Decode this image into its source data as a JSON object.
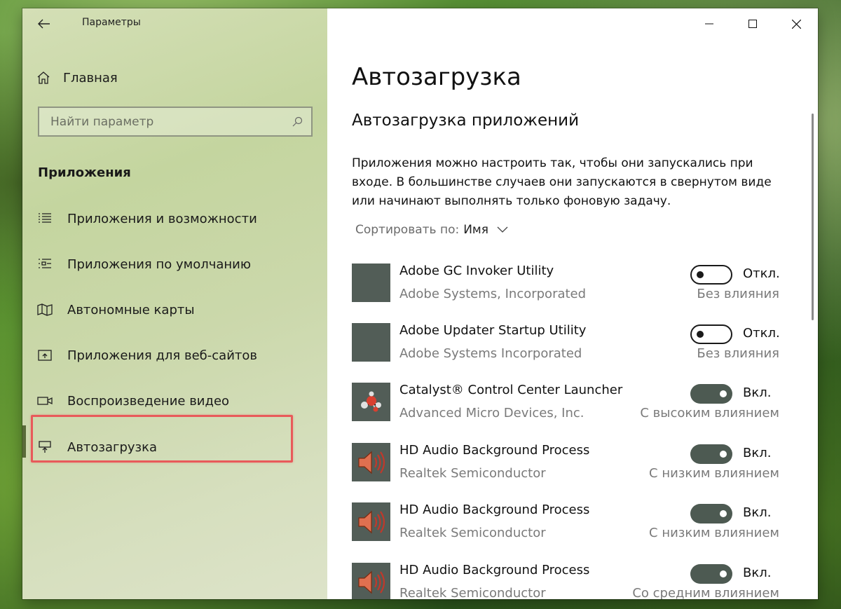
{
  "window": {
    "title": "Параметры"
  },
  "sidebar": {
    "home_label": "Главная",
    "search_placeholder": "Найти параметр",
    "section_title": "Приложения",
    "items": [
      {
        "label": "Приложения и возможности",
        "icon": "apps-features-icon"
      },
      {
        "label": "Приложения по умолчанию",
        "icon": "default-apps-icon"
      },
      {
        "label": "Автономные карты",
        "icon": "offline-maps-icon"
      },
      {
        "label": "Приложения для веб-сайтов",
        "icon": "apps-websites-icon"
      },
      {
        "label": "Воспроизведение видео",
        "icon": "video-playback-icon"
      },
      {
        "label": "Автозагрузка",
        "icon": "startup-icon",
        "active": true
      }
    ]
  },
  "main": {
    "title": "Автозагрузка",
    "subheading": "Автозагрузка приложений",
    "description": "Приложения можно настроить так, чтобы они запускались при входе. В большинстве случаев они запускаются в свернутом виде или начинают выполнять только фоновую задачу.",
    "sort_label": "Сортировать по:",
    "sort_value": "Имя",
    "apps": [
      {
        "name": "Adobe GC Invoker Utility",
        "publisher": "Adobe Systems, Incorporated",
        "state": "Откл.",
        "enabled": false,
        "impact": "Без влияния",
        "icon": "blank"
      },
      {
        "name": "Adobe Updater Startup Utility",
        "publisher": "Adobe Systems Incorporated",
        "state": "Откл.",
        "enabled": false,
        "impact": "Без влияния",
        "icon": "blank"
      },
      {
        "name": "Catalyst® Control Center Launcher",
        "publisher": "Advanced Micro Devices, Inc.",
        "state": "Вкл.",
        "enabled": true,
        "impact": "С высоким влиянием",
        "icon": "catalyst"
      },
      {
        "name": "HD Audio Background Process",
        "publisher": "Realtek Semiconductor",
        "state": "Вкл.",
        "enabled": true,
        "impact": "С низким влиянием",
        "icon": "speaker"
      },
      {
        "name": "HD Audio Background Process",
        "publisher": "Realtek Semiconductor",
        "state": "Вкл.",
        "enabled": true,
        "impact": "С низким влиянием",
        "icon": "speaker"
      },
      {
        "name": "HD Audio Background Process",
        "publisher": "Realtek Semiconductor",
        "state": "Вкл.",
        "enabled": true,
        "impact": "Со средним влиянием",
        "icon": "speaker"
      }
    ]
  },
  "colors": {
    "highlight": "#e85a5a",
    "toggle_on": "#4d5a52",
    "app_tile": "#525d57"
  }
}
